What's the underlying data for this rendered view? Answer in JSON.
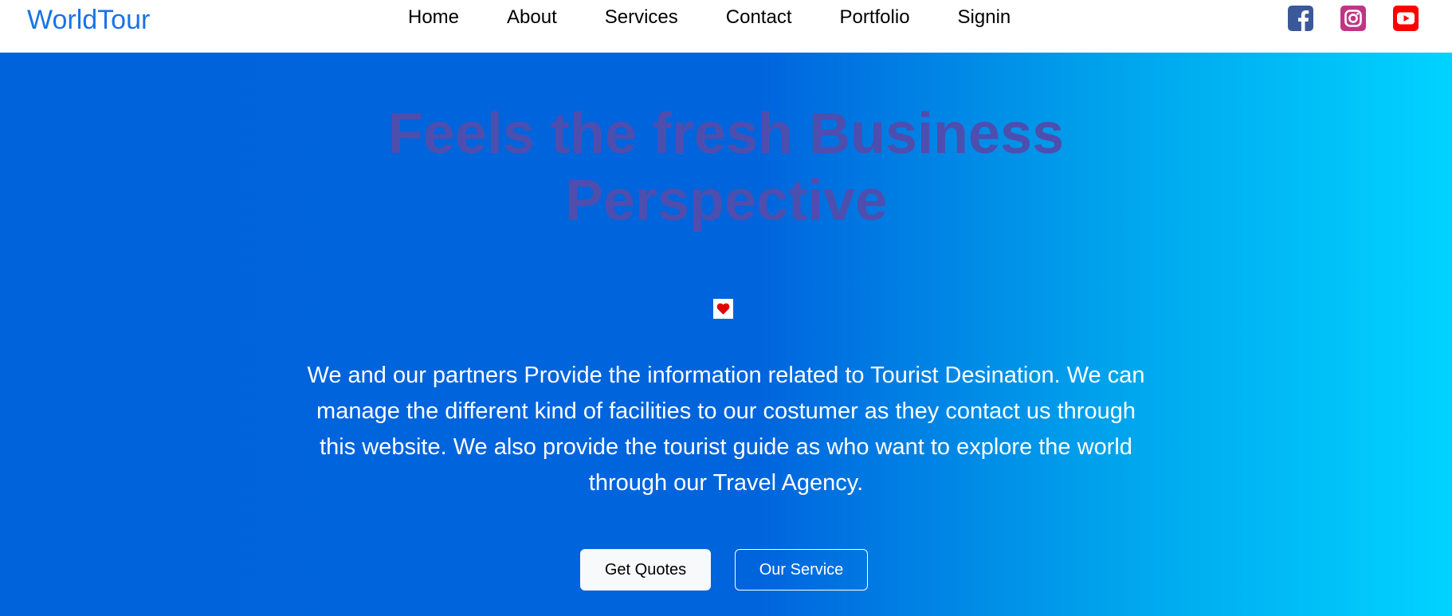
{
  "navbar": {
    "brand": "WorldTour",
    "links": [
      "Home",
      "About",
      "Services",
      "Contact",
      "Portfolio",
      "Signin"
    ],
    "socials": [
      {
        "name": "facebook-icon",
        "color": "#3b5998"
      },
      {
        "name": "instagram-icon",
        "color": "#c13584"
      },
      {
        "name": "youtube-icon",
        "color": "#ff0000"
      }
    ]
  },
  "hero": {
    "title_line1": "Feels the fresh Business",
    "title_line2": "Perspective",
    "title_color": "#4e4eae",
    "heart_icon": "heart-icon",
    "description": "We and our partners Provide the information related to Tourist Desination. We can manage the different kind of facilities to our costumer as they contact us through this website. We also provide the tourist guide as who want to explore the world through our Travel Agency.",
    "primary_button": "Get Quotes",
    "secondary_button": "Our Service",
    "gradient_start": "#0063dc",
    "gradient_end": "#00d3ff"
  }
}
